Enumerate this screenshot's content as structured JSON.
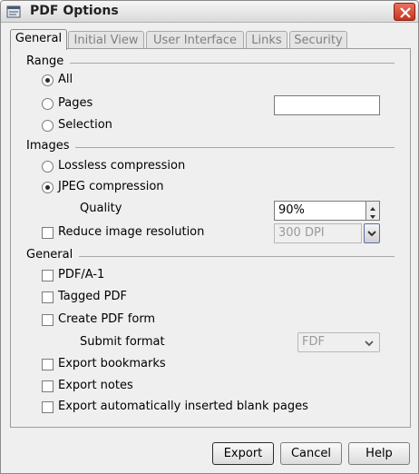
{
  "window": {
    "title": "PDF Options"
  },
  "tabs": [
    {
      "label": "General",
      "active": true
    },
    {
      "label": "Initial View"
    },
    {
      "label": "User Interface"
    },
    {
      "label": "Links"
    },
    {
      "label": "Security"
    }
  ],
  "range": {
    "heading": "Range",
    "all_label": "All",
    "pages_label": "Pages",
    "pages_value": "",
    "selection_label": "Selection",
    "selected": "All"
  },
  "images": {
    "heading": "Images",
    "lossless_label": "Lossless compression",
    "jpeg_label": "JPEG compression",
    "selected": "JPEG compression",
    "quality_label": "Quality",
    "quality_value": "90%",
    "reduce_label": "Reduce image resolution",
    "reduce_checked": false,
    "resolution_value": "300 DPI"
  },
  "general": {
    "heading": "General",
    "pdfa_label": "PDF/A-1",
    "tagged_label": "Tagged PDF",
    "form_label": "Create PDF form",
    "submit_format_label": "Submit format",
    "submit_format_value": "FDF",
    "bookmarks_label": "Export bookmarks",
    "notes_label": "Export notes",
    "blank_pages_label": "Export automatically inserted blank pages"
  },
  "buttons": {
    "export": "Export",
    "cancel": "Cancel",
    "help": "Help"
  },
  "colors": {
    "close_button": "#c8321e",
    "panel_bg": "#efefef"
  }
}
